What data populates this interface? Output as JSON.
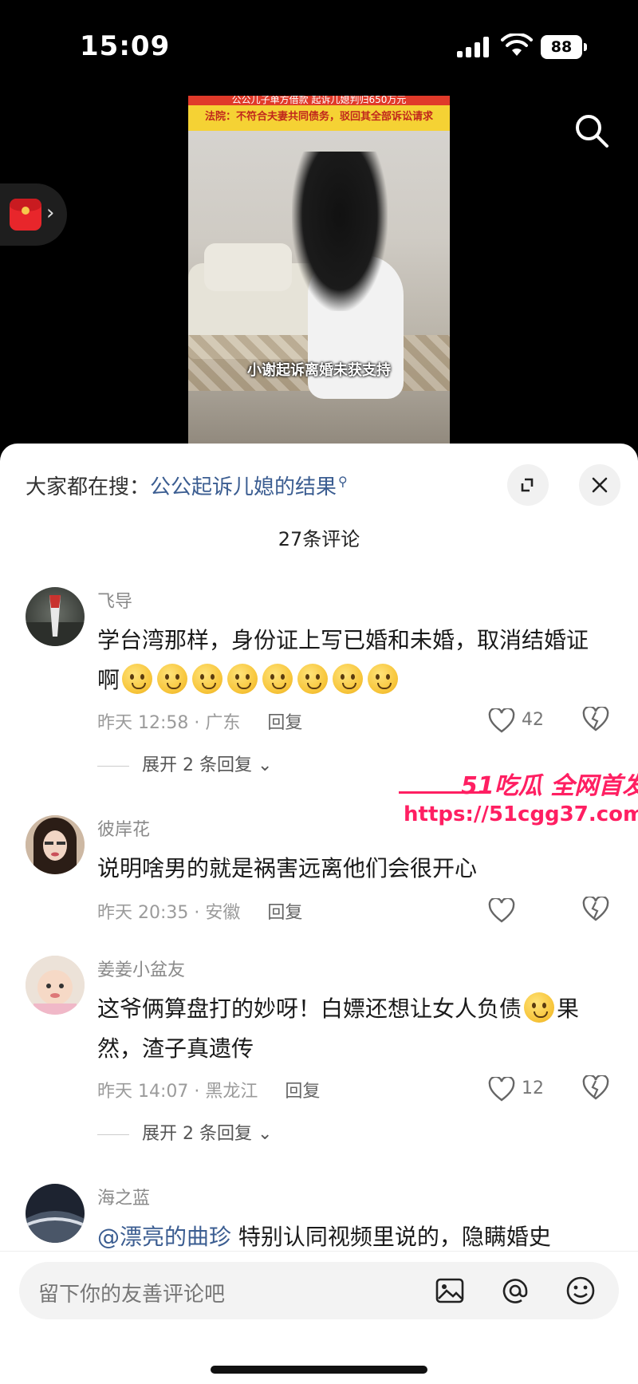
{
  "status_bar": {
    "time": "15:09",
    "battery": "88"
  },
  "video": {
    "banner_line1": "公公儿子单方借款 起诉儿媳判归650万元",
    "banner_line2": "法院：不符合夫妻共同债务，驳回其全部诉讼请求",
    "caption": "小谢起诉离婚未获支持"
  },
  "sheet": {
    "hot_search_prefix": "大家都在搜：",
    "hot_search_query": "公公起诉儿媳的结果",
    "comment_count": "27条评论"
  },
  "comments": [
    {
      "username": "飞导",
      "text_before": "学台湾那样，身份证上写已婚和未婚，取消结婚证啊",
      "emoji_count": 8,
      "meta": "昨天 12:58 · 广东",
      "reply": "回复",
      "likes": "42",
      "expand": "展开 2 条回复"
    },
    {
      "username": "彼岸花",
      "text": "说明啥男的就是祸害远离他们会很开心",
      "meta": "昨天 20:35 · 安徽",
      "reply": "回复"
    },
    {
      "username": "姜姜小盆友",
      "text_before": "这爷俩算盘打的妙呀！白嫖还想让女人负债",
      "text_after": "果然，渣子真遗传",
      "meta": "昨天 14:07 · 黑龙江",
      "reply": "回复",
      "likes": "12",
      "expand": "展开 2 条回复"
    },
    {
      "username": "海之蓝",
      "mention": "@漂亮的曲珍",
      "text": " 特别认同视频里说的，隐瞒婚史"
    }
  ],
  "watermark": {
    "top": "51吃瓜 全网首发",
    "url": "https://51cgg37.com"
  },
  "input": {
    "placeholder": "留下你的友善评论吧"
  }
}
